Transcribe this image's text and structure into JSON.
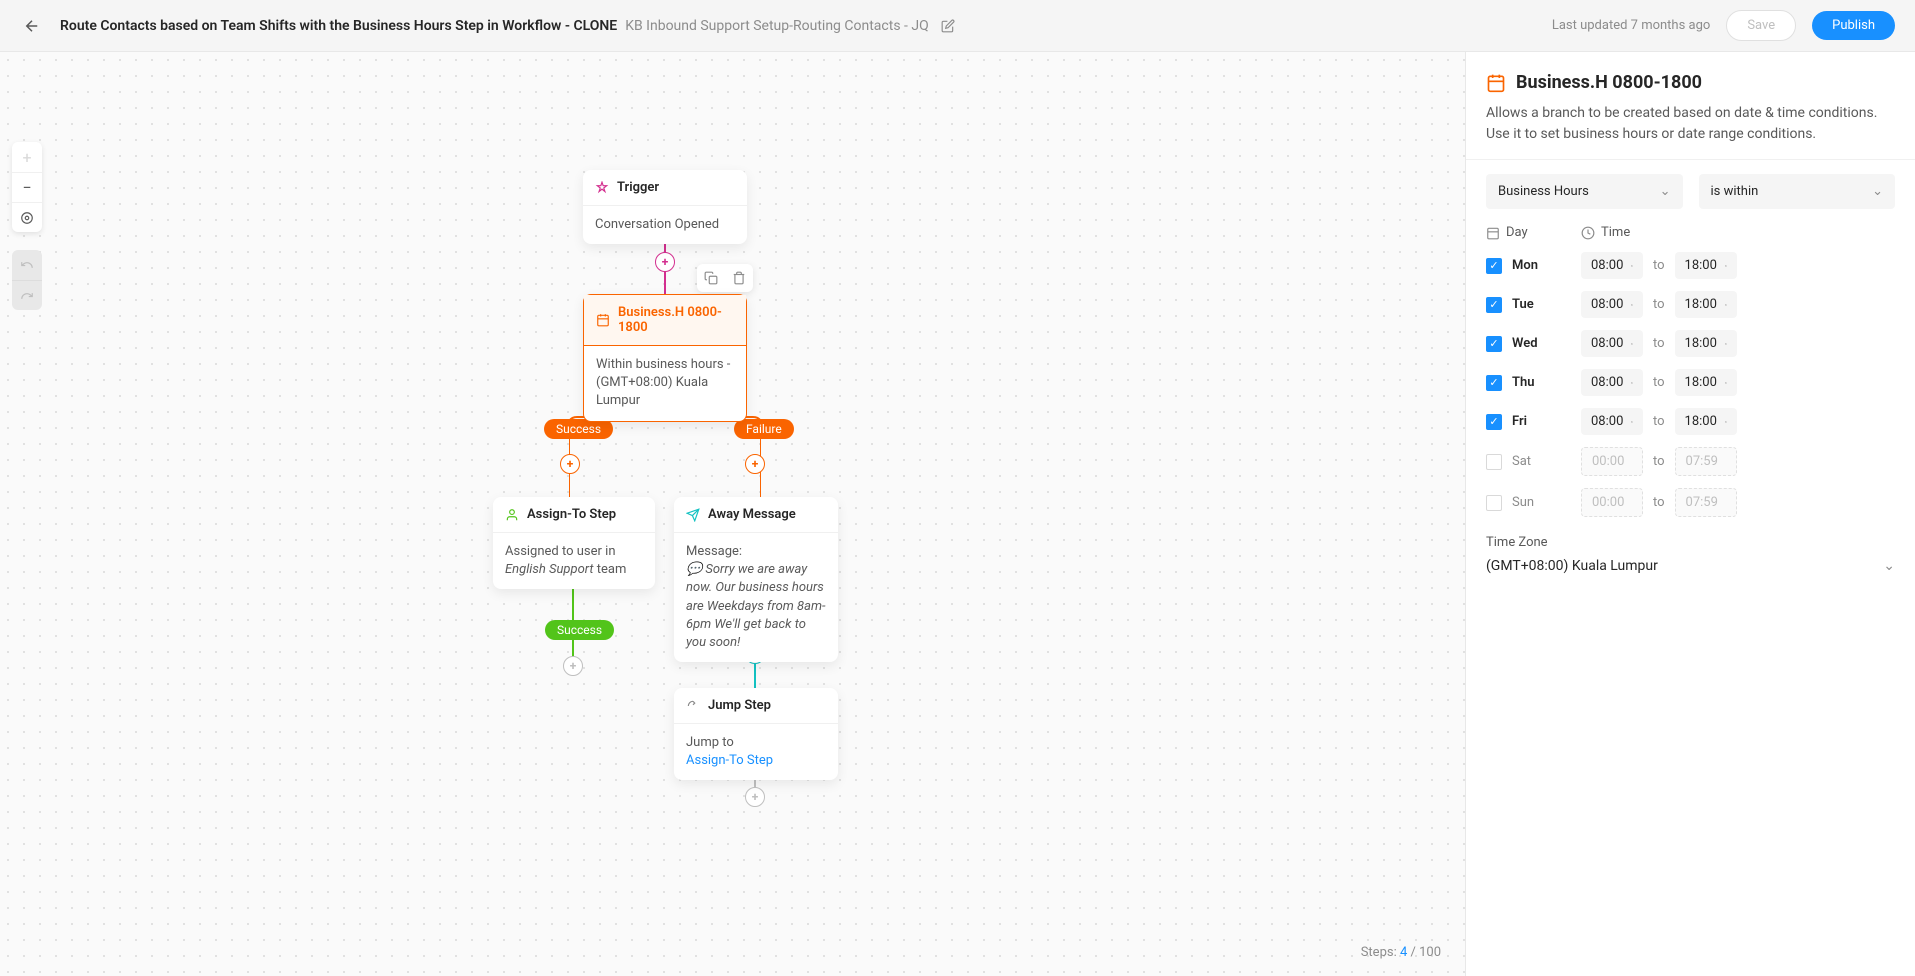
{
  "header": {
    "title": "Route Contacts based on Team Shifts with the Business Hours Step in Workflow - CLONE",
    "subtitle": "KB Inbound Support Setup-Routing Contacts - JQ",
    "last_updated": "Last updated 7 months ago",
    "save_label": "Save",
    "publish_label": "Publish"
  },
  "nodes": {
    "trigger": {
      "title": "Trigger",
      "body": "Conversation Opened"
    },
    "businesshours": {
      "title": "Business.H 0800-1800",
      "body": "Within business hours - (GMT+08:00) Kuala Lumpur"
    },
    "assign": {
      "title": "Assign-To Step",
      "body_prefix": "Assigned to user in ",
      "team_name": "English Support",
      "body_suffix": " team"
    },
    "away": {
      "title": "Away Message",
      "label": "Message:",
      "text": "💬 Sorry we are away now. Our business hours are Weekdays from 8am-6pm We'll get back to you soon!"
    },
    "jump": {
      "title": "Jump Step",
      "label": "Jump to",
      "target": "Assign-To Step"
    }
  },
  "pills": {
    "success": "Success",
    "failure": "Failure"
  },
  "footer": {
    "prefix": "Steps: ",
    "current": "4",
    "total": " / 100"
  },
  "sidebar": {
    "title": "Business.H 0800-1800",
    "desc": "Allows a branch to be created based on date & time conditions. Use it to set business hours or date range conditions.",
    "condition_type": "Business Hours",
    "condition_op": "is within",
    "day_header": "Day",
    "time_header": "Time",
    "time_sep": "to",
    "days": [
      {
        "name": "Mon",
        "checked": true,
        "start": "08:00",
        "end": "18:00"
      },
      {
        "name": "Tue",
        "checked": true,
        "start": "08:00",
        "end": "18:00"
      },
      {
        "name": "Wed",
        "checked": true,
        "start": "08:00",
        "end": "18:00"
      },
      {
        "name": "Thu",
        "checked": true,
        "start": "08:00",
        "end": "18:00"
      },
      {
        "name": "Fri",
        "checked": true,
        "start": "08:00",
        "end": "18:00"
      },
      {
        "name": "Sat",
        "checked": false,
        "start": "00:00",
        "end": "07:59"
      },
      {
        "name": "Sun",
        "checked": false,
        "start": "00:00",
        "end": "07:59"
      }
    ],
    "tz_label": "Time Zone",
    "tz_value": "(GMT+08:00) Kuala Lumpur"
  }
}
